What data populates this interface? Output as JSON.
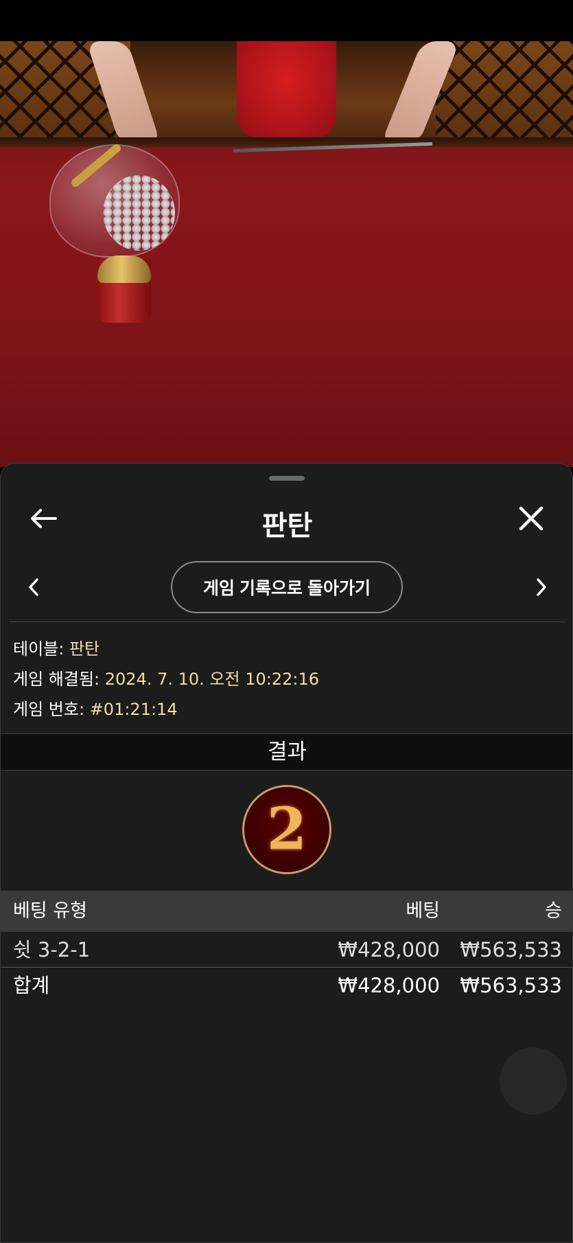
{
  "header": {
    "title": "판탄"
  },
  "navigation": {
    "history_button": "게임 기록으로 돌아가기"
  },
  "info": {
    "table_label": "테이블:",
    "table_value": "판탄",
    "resolved_label": "게임 해결됨:",
    "resolved_value": "2024. 7. 10. 오전 10:22:16",
    "game_number_label": "게임 번호:",
    "game_number_value": "#01:21:14"
  },
  "results": {
    "title": "결과",
    "winning_number": "2"
  },
  "bets": {
    "columns": {
      "type": "베팅 유형",
      "bet": "베팅",
      "win": "승"
    },
    "rows": [
      {
        "type": "쉿 3-2-1",
        "bet": "₩428,000",
        "win": "₩563,533"
      }
    ],
    "total": {
      "label": "합계",
      "bet": "₩428,000",
      "win": "₩563,533"
    }
  },
  "colors": {
    "sheet_bg": "#1c1c1c",
    "accent_value": "#f4dfa0",
    "badge_ring": "#c79a6a",
    "badge_bg": "#3a0000"
  },
  "icons": {
    "back": "arrow-left-icon",
    "close": "close-icon",
    "prev": "chevron-left-icon",
    "next": "chevron-right-icon"
  }
}
